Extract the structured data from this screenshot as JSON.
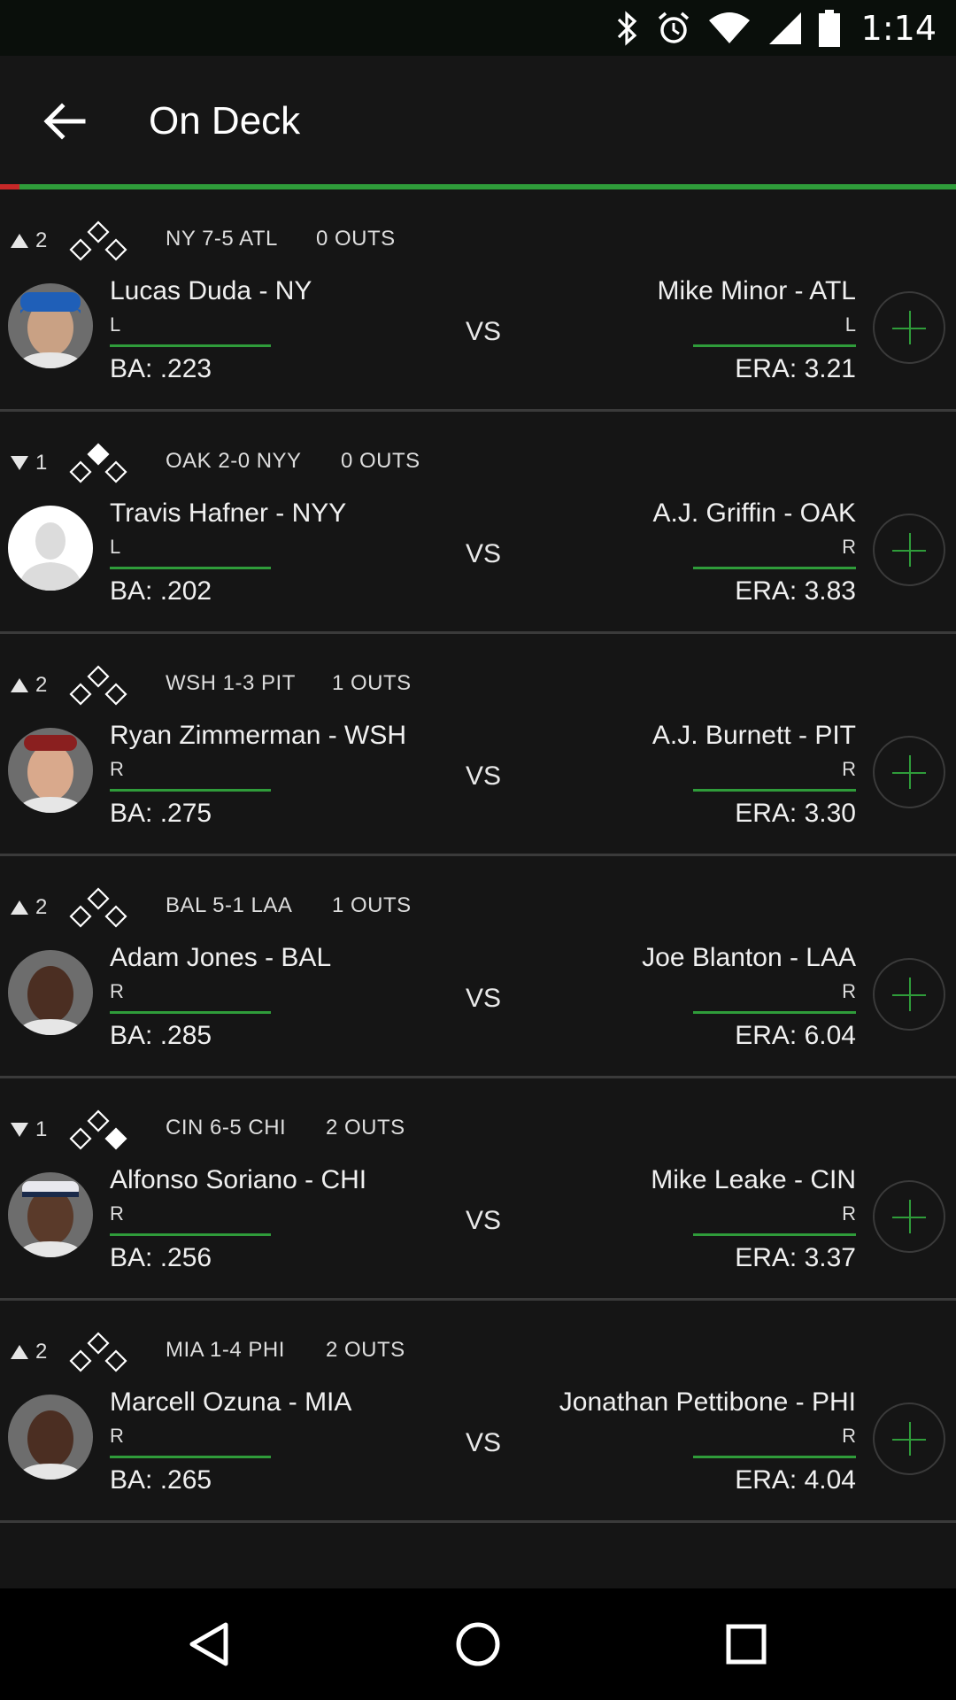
{
  "status": {
    "time": "1:14"
  },
  "appbar": {
    "title": "On Deck"
  },
  "matchups": [
    {
      "inning": "2",
      "dir": "up",
      "bases": [
        false,
        false,
        false
      ],
      "score": "NY 7-5 ATL",
      "outs": "0 OUTS",
      "batter": {
        "name": "Lucas Duda - NY",
        "hand": "L",
        "stat": "BA: .223",
        "avatar": "blue-cap"
      },
      "vs": "VS",
      "pitcher": {
        "name": "Mike Minor - ATL",
        "hand": "L",
        "stat": "ERA: 3.21"
      }
    },
    {
      "inning": "1",
      "dir": "down",
      "bases": [
        false,
        true,
        false
      ],
      "score": "OAK 2-0 NYY",
      "outs": "0 OUTS",
      "batter": {
        "name": "Travis Hafner - NYY",
        "hand": "L",
        "stat": "BA: .202",
        "avatar": "placeholder"
      },
      "vs": "VS",
      "pitcher": {
        "name": "A.J. Griffin - OAK",
        "hand": "R",
        "stat": "ERA: 3.83"
      }
    },
    {
      "inning": "2",
      "dir": "up",
      "bases": [
        false,
        false,
        false
      ],
      "score": "WSH 1-3 PIT",
      "outs": "1 OUTS",
      "batter": {
        "name": "Ryan Zimmerman - WSH",
        "hand": "R",
        "stat": "BA: .275",
        "avatar": "face-light"
      },
      "vs": "VS",
      "pitcher": {
        "name": "A.J. Burnett - PIT",
        "hand": "R",
        "stat": "ERA: 3.30"
      }
    },
    {
      "inning": "2",
      "dir": "up",
      "bases": [
        false,
        false,
        false
      ],
      "score": "BAL 5-1 LAA",
      "outs": "1 OUTS",
      "batter": {
        "name": "Adam Jones - BAL",
        "hand": "R",
        "stat": "BA: .285",
        "avatar": "face-dark"
      },
      "vs": "VS",
      "pitcher": {
        "name": "Joe Blanton - LAA",
        "hand": "R",
        "stat": "ERA: 6.04"
      }
    },
    {
      "inning": "1",
      "dir": "down",
      "bases": [
        true,
        false,
        false
      ],
      "score": "CIN 6-5 CHI",
      "outs": "2 OUTS",
      "batter": {
        "name": "Alfonso Soriano - CHI",
        "hand": "R",
        "stat": "BA: .256",
        "avatar": "face-dark-cap"
      },
      "vs": "VS",
      "pitcher": {
        "name": "Mike Leake - CIN",
        "hand": "R",
        "stat": "ERA: 3.37"
      }
    },
    {
      "inning": "2",
      "dir": "up",
      "bases": [
        false,
        false,
        false
      ],
      "score": "MIA 1-4 PHI",
      "outs": "2 OUTS",
      "batter": {
        "name": "Marcell Ozuna - MIA",
        "hand": "R",
        "stat": "BA: .265",
        "avatar": "face-dark"
      },
      "vs": "VS",
      "pitcher": {
        "name": "Jonathan Pettibone - PHI",
        "hand": "R",
        "stat": "ERA: 4.04"
      }
    }
  ],
  "icons": {
    "back": "arrow-back-icon",
    "bluetooth": "bluetooth-icon",
    "alarm": "alarm-icon",
    "wifi": "wifi-icon",
    "signal": "signal-icon",
    "battery": "battery-icon",
    "nav_back": "nav-back-icon",
    "nav_home": "nav-home-icon",
    "nav_recents": "nav-recents-icon"
  },
  "colors": {
    "accent": "#2f9c3a",
    "progress_start": "#c62828",
    "background": "#151515"
  }
}
